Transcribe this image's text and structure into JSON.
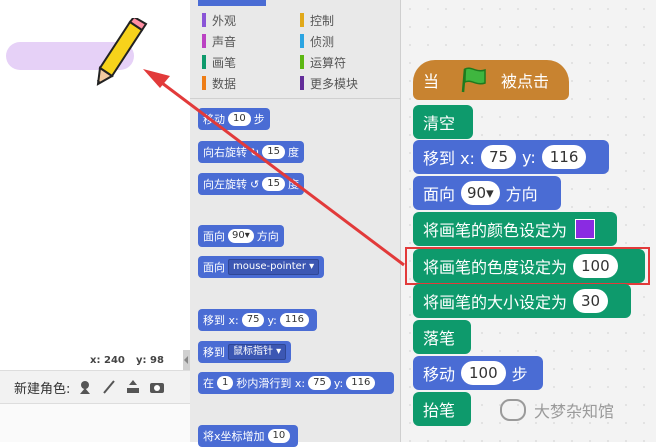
{
  "stage": {
    "coords": {
      "x_label": "x:",
      "x_value": "240",
      "y_label": "y:",
      "y_value": "98"
    },
    "new_sprite_label": "新建角色:",
    "new_sprite_icons": [
      "sprite-library-icon",
      "paint-brush-icon",
      "upload-icon",
      "camera-icon"
    ]
  },
  "palette": {
    "categories": [
      {
        "label": "外观",
        "color": "#8a55d7"
      },
      {
        "label": "控制",
        "color": "#e1a91a"
      },
      {
        "label": "声音",
        "color": "#bb42c3"
      },
      {
        "label": "侦测",
        "color": "#2ca5e2"
      },
      {
        "label": "画笔",
        "color": "#0e9a6c"
      },
      {
        "label": "运算符",
        "color": "#5cb712"
      },
      {
        "label": "数据",
        "color": "#ee7d16"
      },
      {
        "label": "更多模块",
        "color": "#632d99"
      }
    ],
    "blocks": {
      "move": {
        "text_a": "移动",
        "value": "10",
        "text_b": "步"
      },
      "turn_right": {
        "text_a": "向右旋转",
        "icon": "↻",
        "value": "15",
        "text_b": "度"
      },
      "turn_left": {
        "text_a": "向左旋转",
        "icon": "↺",
        "value": "15",
        "text_b": "度"
      },
      "point_dir": {
        "text_a": "面向",
        "value": "90▾",
        "text_b": "方向"
      },
      "point_towards": {
        "text_a": "面向",
        "value": "mouse-pointer ▾"
      },
      "goto_xy": {
        "text_a": "移到 x:",
        "x": "75",
        "text_b": "y:",
        "y": "116"
      },
      "goto": {
        "text_a": "移到",
        "value": "鼠标指针 ▾"
      },
      "glide": {
        "text_a": "在",
        "secs": "1",
        "text_b": "秒内滑行到 x:",
        "x": "75",
        "text_c": "y:",
        "y": "116"
      },
      "change_x": {
        "text_a": "将x坐标增加",
        "value": "10"
      }
    }
  },
  "script": {
    "hat": {
      "text_a": "当",
      "text_b": "被点击"
    },
    "clear": "清空",
    "goto_xy": {
      "text_a": "移到 x:",
      "x": "75",
      "text_b": "y:",
      "y": "116"
    },
    "point_dir": {
      "text_a": "面向",
      "value": "90▾",
      "text_b": "方向"
    },
    "set_color": {
      "text": "将画笔的颜色设定为",
      "color": "#8a2be2"
    },
    "set_shade": {
      "text": "将画笔的色度设定为",
      "value": "100"
    },
    "set_size": {
      "text": "将画笔的大小设定为",
      "value": "30"
    },
    "pen_down": "落笔",
    "move": {
      "text_a": "移动",
      "value": "100",
      "text_b": "步"
    },
    "pen_up": "抬笔"
  },
  "watermark": {
    "text": "大梦杂知馆"
  },
  "colors": {
    "motion": "#4a6cd4",
    "pen": "#0e9a6c",
    "event": "#c88330",
    "highlight": "#e23a3a"
  }
}
